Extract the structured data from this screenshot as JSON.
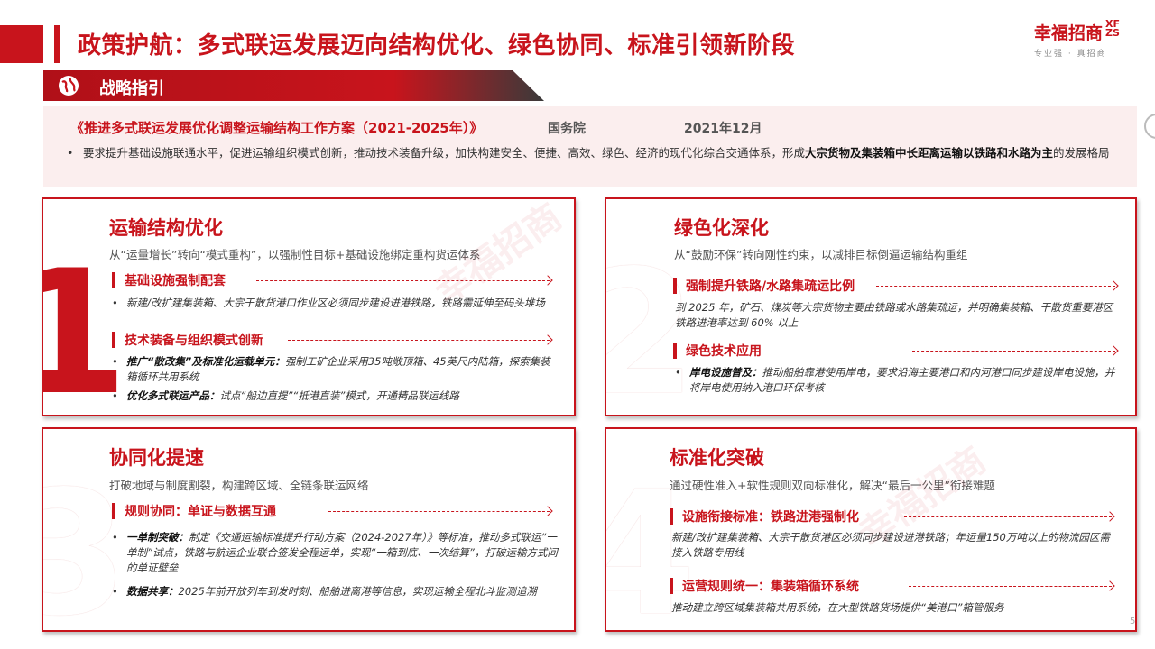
{
  "header": {
    "title": "政策护航：多式联运发展迈向结构优化、绿色协同、标准引领新阶段",
    "logo_main": "幸福招商",
    "logo_xf": "XF ZS",
    "logo_slogan": "专业强 · 真招商"
  },
  "nav": {
    "label": "战略指引"
  },
  "directive": {
    "name": "《推进多式联运发展优化调整运输结构工作方案（2021-2025年）》",
    "issuer": "国务院",
    "date": "2021年12月",
    "bullet_dot": "•",
    "text_normal": "要求提升基础设施联通水平，促进运输组织模式创新，推动技术装备升级，加快构建安全、便捷、高效、绿色、经济的现代化综合交通体系，形成",
    "text_bold": "大宗货物及集装箱中长距离运输以铁路和水路为主",
    "text_tail": "的发展格局"
  },
  "panels": [
    {
      "num": "1",
      "title": "运输结构优化",
      "subtitle": "从“运量增长”转向“模式重构”，以强制性目标+基础设施绑定重构货运体系",
      "sections": [
        {
          "label": "基础设施强制配套",
          "bullets": [
            {
              "bold": "",
              "text": "新建/改扩建集装箱、大宗干散货港口作业区必须同步建设进港铁路，铁路需延伸至码头堆场"
            }
          ]
        },
        {
          "label": "技术装备与组织模式创新",
          "bullets": [
            {
              "bold": "推广“散改集”及标准化运载单元：",
              "text": "强制工矿企业采用35吨敞顶箱、45英尺内陆箱，探索集装箱循环共用系统"
            },
            {
              "bold": "优化多式联运产品：",
              "text": "试点“船边直提”“抵港直装”模式，开通精品联运线路"
            }
          ]
        }
      ]
    },
    {
      "num": "2",
      "title": "绿色化深化",
      "subtitle": "从“鼓励环保”转向刚性约束，以减排目标倒逼运输结构重组",
      "sections": [
        {
          "label": "强制提升铁路/水路集疏运比例",
          "bullets": [
            {
              "bold": "",
              "text": "到 2025 年，矿石、煤炭等大宗货物主要由铁路或水路集疏运，并明确集装箱、干散货重要港区铁路进港率达到 60% 以上"
            }
          ]
        },
        {
          "label": "绿色技术应用",
          "bullets": [
            {
              "bold": "岸电设施普及：",
              "text": "推动船舶靠港使用岸电，要求沿海主要港口和内河港口同步建设岸电设施，并将岸电使用纳入港口环保考核"
            }
          ]
        }
      ]
    },
    {
      "num": "3",
      "title": "协同化提速",
      "subtitle": "打破地域与制度割裂，构建跨区域、全链条联运网络",
      "sections": [
        {
          "label": "规则协同：单证与数据互通",
          "bullets": [
            {
              "bold": "一单制突破：",
              "text": "制定《交通运输标准提升行动方案（2024-2027年）》等标准，推动多式联运“一单制”试点，铁路与航运企业联合签发全程运单，实现“一箱到底、一次结算”，打破运输方式间的单证壁垒"
            },
            {
              "bold": "数据共享：",
              "text": "2025年前开放列车到发时刻、船舶进离港等信息，实现运输全程北斗监测追溯"
            }
          ]
        }
      ]
    },
    {
      "num": "4",
      "title": "标准化突破",
      "subtitle": "通过硬性准入+软性规则双向标准化，解决“最后一公里”衔接难题",
      "sections": [
        {
          "label": "设施衔接标准：铁路进港强制化",
          "bullets": [
            {
              "bold": "",
              "text": "新建/改扩建集装箱、大宗干散货港区必须同步建设进港铁路；年运量150万吨以上的物流园区需接入铁路专用线"
            }
          ]
        },
        {
          "label": "运营规则统一：集装箱循环系统",
          "bullets": [
            {
              "bold": "",
              "text": "推动建立跨区域集装箱共用系统，在大型铁路货场提供“美港口”箱管服务"
            }
          ]
        }
      ]
    }
  ],
  "footer": {
    "page": "5"
  },
  "colors": {
    "brand_red": "#c8141c",
    "panel_tint": "#fbeeee"
  },
  "icons": {
    "nav": "globe-icon"
  }
}
